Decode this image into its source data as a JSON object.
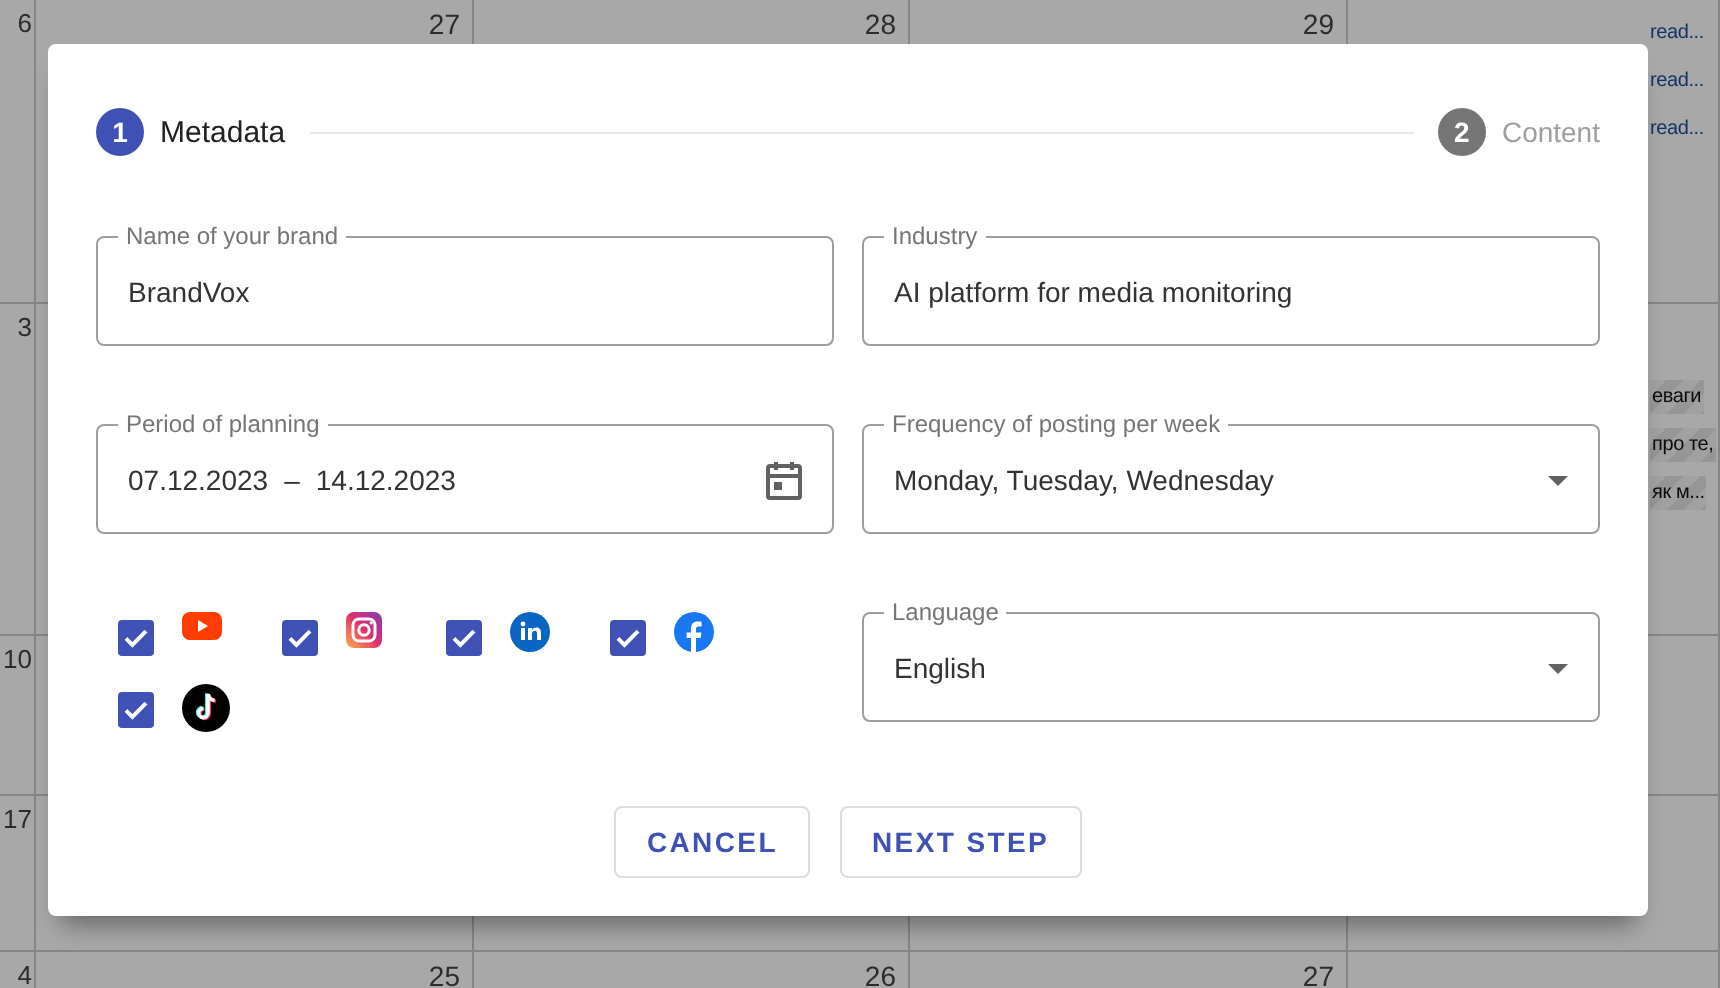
{
  "calendar": {
    "rows": [
      {
        "days": [
          "6",
          "27",
          "28",
          "29"
        ],
        "events": [
          {
            "title": "read...",
            "striped": false
          },
          {
            "title": "read...",
            "striped": false
          },
          {
            "title": "read...",
            "striped": false
          }
        ]
      },
      {
        "days": [
          "3"
        ],
        "events": [
          {
            "title": "еваги",
            "striped": true
          },
          {
            "title": "про те,",
            "striped": true
          },
          {
            "title": "як м...",
            "striped": true
          }
        ]
      },
      {
        "days": [
          "10"
        ]
      },
      {
        "days": [
          "17"
        ]
      },
      {
        "days": [
          "4",
          "25",
          "26",
          "27"
        ]
      }
    ]
  },
  "dialog": {
    "steps": [
      {
        "number": "1",
        "label": "Metadata",
        "selected": true
      },
      {
        "number": "2",
        "label": "Content",
        "selected": false
      }
    ],
    "fields": [
      {
        "kind": "text",
        "label": "Name of your brand",
        "value": "BrandVox"
      },
      {
        "kind": "text",
        "label": "Industry",
        "value": "AI platform for media monitoring"
      },
      {
        "kind": "date",
        "label": "Period of planning",
        "start": "07.12.2023",
        "separator": "–",
        "end": "14.12.2023"
      },
      {
        "kind": "select",
        "label": "Frequency of posting per week",
        "value": "Monday, Tuesday, Wednesday"
      },
      {
        "kind": "socials",
        "networks": [
          {
            "kind": "youtube",
            "checked": true
          },
          {
            "kind": "instagram",
            "checked": true
          },
          {
            "kind": "linkedin",
            "checked": true
          },
          {
            "kind": "facebook",
            "checked": true
          },
          {
            "kind": "tiktok",
            "checked": true
          }
        ]
      },
      {
        "kind": "select",
        "label": "Language",
        "value": "English"
      }
    ],
    "buttons": [
      {
        "label": "CANCEL"
      },
      {
        "label": "NEXT STEP"
      }
    ]
  }
}
